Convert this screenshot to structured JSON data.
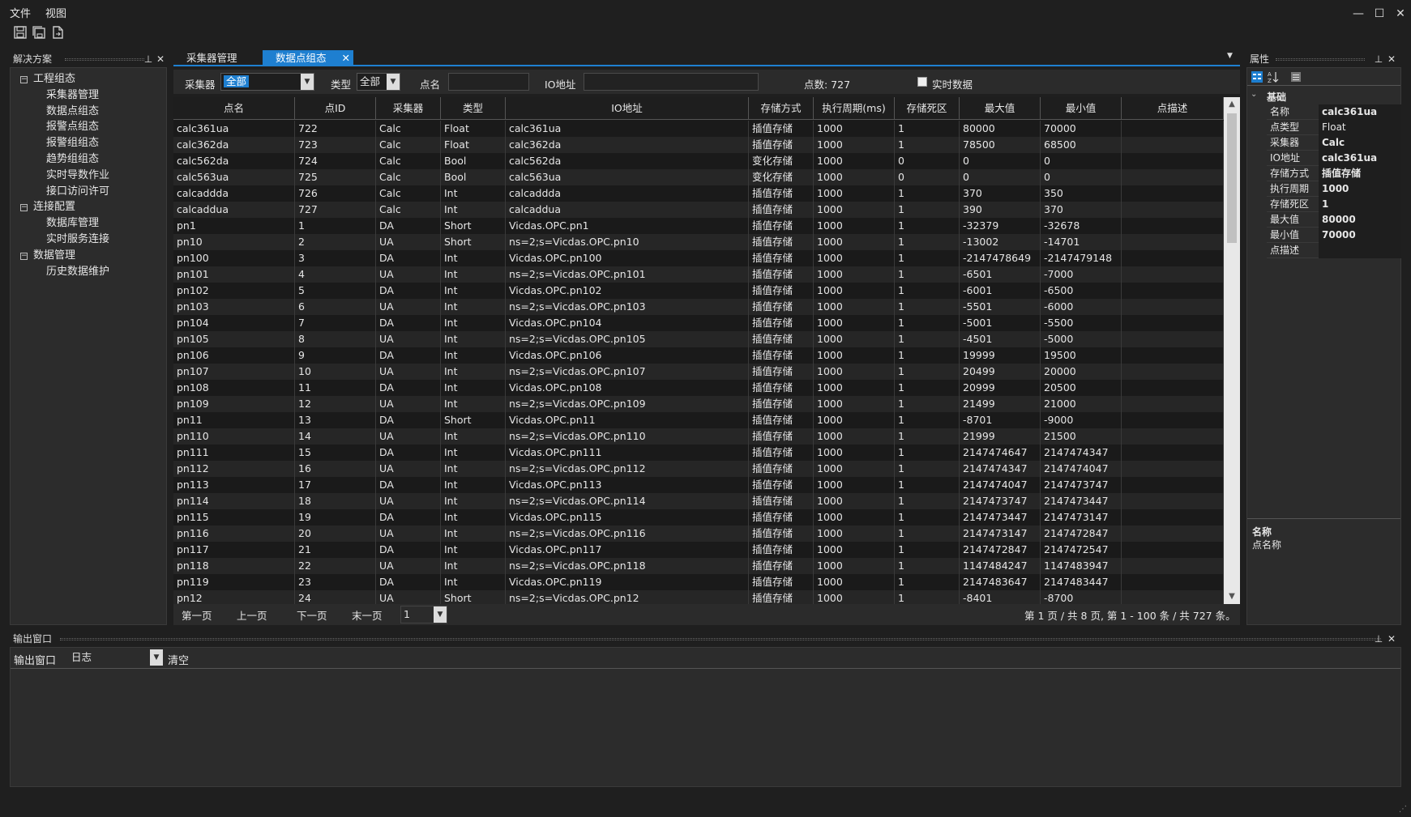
{
  "menu": [
    "文件",
    "视图"
  ],
  "window_buttons": {
    "minimize": "—",
    "maximize": "☐",
    "close": "✕"
  },
  "solution": {
    "title": "解决方案",
    "tree": [
      {
        "label": "工程组态",
        "level": 0,
        "toggle": "−"
      },
      {
        "label": "采集器管理",
        "level": 1
      },
      {
        "label": "数据点组态",
        "level": 1
      },
      {
        "label": "报警点组态",
        "level": 1
      },
      {
        "label": "报警组组态",
        "level": 1
      },
      {
        "label": "趋势组组态",
        "level": 1
      },
      {
        "label": "实时导数作业",
        "level": 1
      },
      {
        "label": "接口访问许可",
        "level": 1
      },
      {
        "label": "连接配置",
        "level": 0,
        "toggle": "−"
      },
      {
        "label": "数据库管理",
        "level": 1
      },
      {
        "label": "实时服务连接",
        "level": 1
      },
      {
        "label": "数据管理",
        "level": 0,
        "toggle": "−"
      },
      {
        "label": "历史数据维护",
        "level": 1
      }
    ]
  },
  "tabs": [
    {
      "label": "采集器管理",
      "active": false
    },
    {
      "label": "数据点组态",
      "active": true,
      "close": "✕"
    }
  ],
  "filter": {
    "collector_label": "采集器",
    "collector_value": "全部",
    "type_label": "类型",
    "type_value": "全部",
    "point_name_label": "点名",
    "io_label": "IO地址",
    "count_text": "点数: 727",
    "realtime_label": "实时数据"
  },
  "grid": {
    "columns": [
      "点名",
      "点ID",
      "采集器",
      "类型",
      "IO地址",
      "存储方式",
      "执行周期(ms)",
      "存储死区",
      "最大值",
      "最小值",
      "点描述"
    ],
    "rows": [
      [
        "calc361ua",
        "722",
        "Calc",
        "Float",
        "calc361ua",
        "插值存储",
        "1000",
        "1",
        "80000",
        "70000",
        ""
      ],
      [
        "calc362da",
        "723",
        "Calc",
        "Float",
        "calc362da",
        "插值存储",
        "1000",
        "1",
        "78500",
        "68500",
        ""
      ],
      [
        "calc562da",
        "724",
        "Calc",
        "Bool",
        "calc562da",
        "变化存储",
        "1000",
        "0",
        "0",
        "0",
        ""
      ],
      [
        "calc563ua",
        "725",
        "Calc",
        "Bool",
        "calc563ua",
        "变化存储",
        "1000",
        "0",
        "0",
        "0",
        ""
      ],
      [
        "calcaddda",
        "726",
        "Calc",
        "Int",
        "calcaddda",
        "插值存储",
        "1000",
        "1",
        "370",
        "350",
        ""
      ],
      [
        "calcaddua",
        "727",
        "Calc",
        "Int",
        "calcaddua",
        "插值存储",
        "1000",
        "1",
        "390",
        "370",
        ""
      ],
      [
        "pn1",
        "1",
        "DA",
        "Short",
        "Vicdas.OPC.pn1",
        "插值存储",
        "1000",
        "1",
        "-32379",
        "-32678",
        ""
      ],
      [
        "pn10",
        "2",
        "UA",
        "Short",
        "ns=2;s=Vicdas.OPC.pn10",
        "插值存储",
        "1000",
        "1",
        "-13002",
        "-14701",
        ""
      ],
      [
        "pn100",
        "3",
        "DA",
        "Int",
        "Vicdas.OPC.pn100",
        "插值存储",
        "1000",
        "1",
        "-2147478649",
        "-2147479148",
        ""
      ],
      [
        "pn101",
        "4",
        "UA",
        "Int",
        "ns=2;s=Vicdas.OPC.pn101",
        "插值存储",
        "1000",
        "1",
        "-6501",
        "-7000",
        ""
      ],
      [
        "pn102",
        "5",
        "DA",
        "Int",
        "Vicdas.OPC.pn102",
        "插值存储",
        "1000",
        "1",
        "-6001",
        "-6500",
        ""
      ],
      [
        "pn103",
        "6",
        "UA",
        "Int",
        "ns=2;s=Vicdas.OPC.pn103",
        "插值存储",
        "1000",
        "1",
        "-5501",
        "-6000",
        ""
      ],
      [
        "pn104",
        "7",
        "DA",
        "Int",
        "Vicdas.OPC.pn104",
        "插值存储",
        "1000",
        "1",
        "-5001",
        "-5500",
        ""
      ],
      [
        "pn105",
        "8",
        "UA",
        "Int",
        "ns=2;s=Vicdas.OPC.pn105",
        "插值存储",
        "1000",
        "1",
        "-4501",
        "-5000",
        ""
      ],
      [
        "pn106",
        "9",
        "DA",
        "Int",
        "Vicdas.OPC.pn106",
        "插值存储",
        "1000",
        "1",
        "19999",
        "19500",
        ""
      ],
      [
        "pn107",
        "10",
        "UA",
        "Int",
        "ns=2;s=Vicdas.OPC.pn107",
        "插值存储",
        "1000",
        "1",
        "20499",
        "20000",
        ""
      ],
      [
        "pn108",
        "11",
        "DA",
        "Int",
        "Vicdas.OPC.pn108",
        "插值存储",
        "1000",
        "1",
        "20999",
        "20500",
        ""
      ],
      [
        "pn109",
        "12",
        "UA",
        "Int",
        "ns=2;s=Vicdas.OPC.pn109",
        "插值存储",
        "1000",
        "1",
        "21499",
        "21000",
        ""
      ],
      [
        "pn11",
        "13",
        "DA",
        "Short",
        "Vicdas.OPC.pn11",
        "插值存储",
        "1000",
        "1",
        "-8701",
        "-9000",
        ""
      ],
      [
        "pn110",
        "14",
        "UA",
        "Int",
        "ns=2;s=Vicdas.OPC.pn110",
        "插值存储",
        "1000",
        "1",
        "21999",
        "21500",
        ""
      ],
      [
        "pn111",
        "15",
        "DA",
        "Int",
        "Vicdas.OPC.pn111",
        "插值存储",
        "1000",
        "1",
        "2147474647",
        "2147474347",
        ""
      ],
      [
        "pn112",
        "16",
        "UA",
        "Int",
        "ns=2;s=Vicdas.OPC.pn112",
        "插值存储",
        "1000",
        "1",
        "2147474347",
        "2147474047",
        ""
      ],
      [
        "pn113",
        "17",
        "DA",
        "Int",
        "Vicdas.OPC.pn113",
        "插值存储",
        "1000",
        "1",
        "2147474047",
        "2147473747",
        ""
      ],
      [
        "pn114",
        "18",
        "UA",
        "Int",
        "ns=2;s=Vicdas.OPC.pn114",
        "插值存储",
        "1000",
        "1",
        "2147473747",
        "2147473447",
        ""
      ],
      [
        "pn115",
        "19",
        "DA",
        "Int",
        "Vicdas.OPC.pn115",
        "插值存储",
        "1000",
        "1",
        "2147473447",
        "2147473147",
        ""
      ],
      [
        "pn116",
        "20",
        "UA",
        "Int",
        "ns=2;s=Vicdas.OPC.pn116",
        "插值存储",
        "1000",
        "1",
        "2147473147",
        "2147472847",
        ""
      ],
      [
        "pn117",
        "21",
        "DA",
        "Int",
        "Vicdas.OPC.pn117",
        "插值存储",
        "1000",
        "1",
        "2147472847",
        "2147472547",
        ""
      ],
      [
        "pn118",
        "22",
        "UA",
        "Int",
        "ns=2;s=Vicdas.OPC.pn118",
        "插值存储",
        "1000",
        "1",
        "1147484247",
        "1147483947",
        ""
      ],
      [
        "pn119",
        "23",
        "DA",
        "Int",
        "Vicdas.OPC.pn119",
        "插值存储",
        "1000",
        "1",
        "2147483647",
        "2147483447",
        ""
      ],
      [
        "pn12",
        "24",
        "UA",
        "Short",
        "ns=2;s=Vicdas.OPC.pn12",
        "插值存储",
        "1000",
        "1",
        "-8401",
        "-8700",
        ""
      ]
    ]
  },
  "pager": {
    "first": "第一页",
    "prev": "上一页",
    "next": "下一页",
    "last": "末一页",
    "page_value": "1",
    "status": "第 1 页 / 共 8 页,  第 1 - 100 条 / 共 727 条。"
  },
  "props": {
    "title": "属性",
    "category": "基础",
    "rows": [
      {
        "name": "名称",
        "value": "calc361ua",
        "bold": true
      },
      {
        "name": "点类型",
        "value": "Float",
        "bold": false
      },
      {
        "name": "采集器",
        "value": "Calc",
        "bold": true
      },
      {
        "name": "IO地址",
        "value": "calc361ua",
        "bold": true
      },
      {
        "name": "存储方式",
        "value": "插值存储",
        "bold": true
      },
      {
        "name": "执行周期",
        "value": "1000",
        "bold": true
      },
      {
        "name": "存储死区",
        "value": "1",
        "bold": true
      },
      {
        "name": "最大值",
        "value": "80000",
        "bold": true
      },
      {
        "name": "最小值",
        "value": "70000",
        "bold": true
      },
      {
        "name": "点描述",
        "value": "",
        "bold": false
      }
    ],
    "desc_title": "名称",
    "desc_text": "点名称"
  },
  "output": {
    "title": "输出窗口",
    "label": "输出窗口",
    "log_value": "日志",
    "clear": "清空"
  },
  "colors": {
    "accent": "#1e7fd0",
    "background": "#1f1f1f"
  }
}
